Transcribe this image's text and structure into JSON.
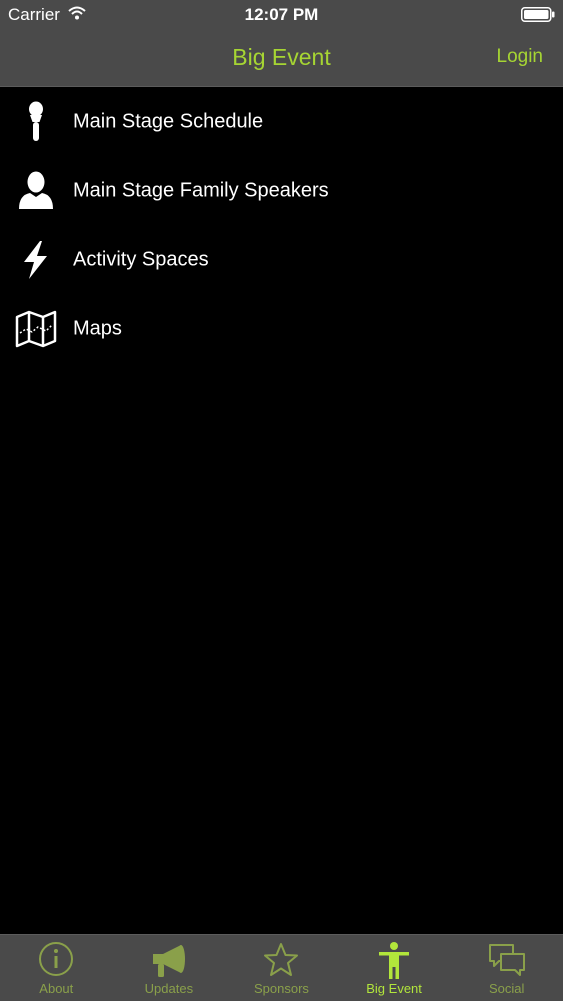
{
  "status_bar": {
    "carrier": "Carrier",
    "time": "12:07 PM"
  },
  "nav": {
    "title": "Big Event",
    "login_label": "Login"
  },
  "menu": {
    "items": [
      {
        "label": "Main Stage Schedule",
        "icon": "microphone-icon"
      },
      {
        "label": "Main Stage Family Speakers",
        "icon": "person-icon"
      },
      {
        "label": "Activity Spaces",
        "icon": "lightning-icon"
      },
      {
        "label": "Maps",
        "icon": "map-icon"
      }
    ]
  },
  "tabbar": {
    "tabs": [
      {
        "label": "About",
        "icon": "info-icon"
      },
      {
        "label": "Updates",
        "icon": "megaphone-icon"
      },
      {
        "label": "Sponsors",
        "icon": "star-icon"
      },
      {
        "label": "Big Event",
        "icon": "figure-icon"
      },
      {
        "label": "Social",
        "icon": "chat-bubbles-icon"
      }
    ],
    "active_tab": "Big Event"
  },
  "colors": {
    "accent": "#a6d533",
    "bar_background": "#4a4a4a",
    "content_background": "#000000",
    "tab_inactive": "#8aa04a"
  }
}
